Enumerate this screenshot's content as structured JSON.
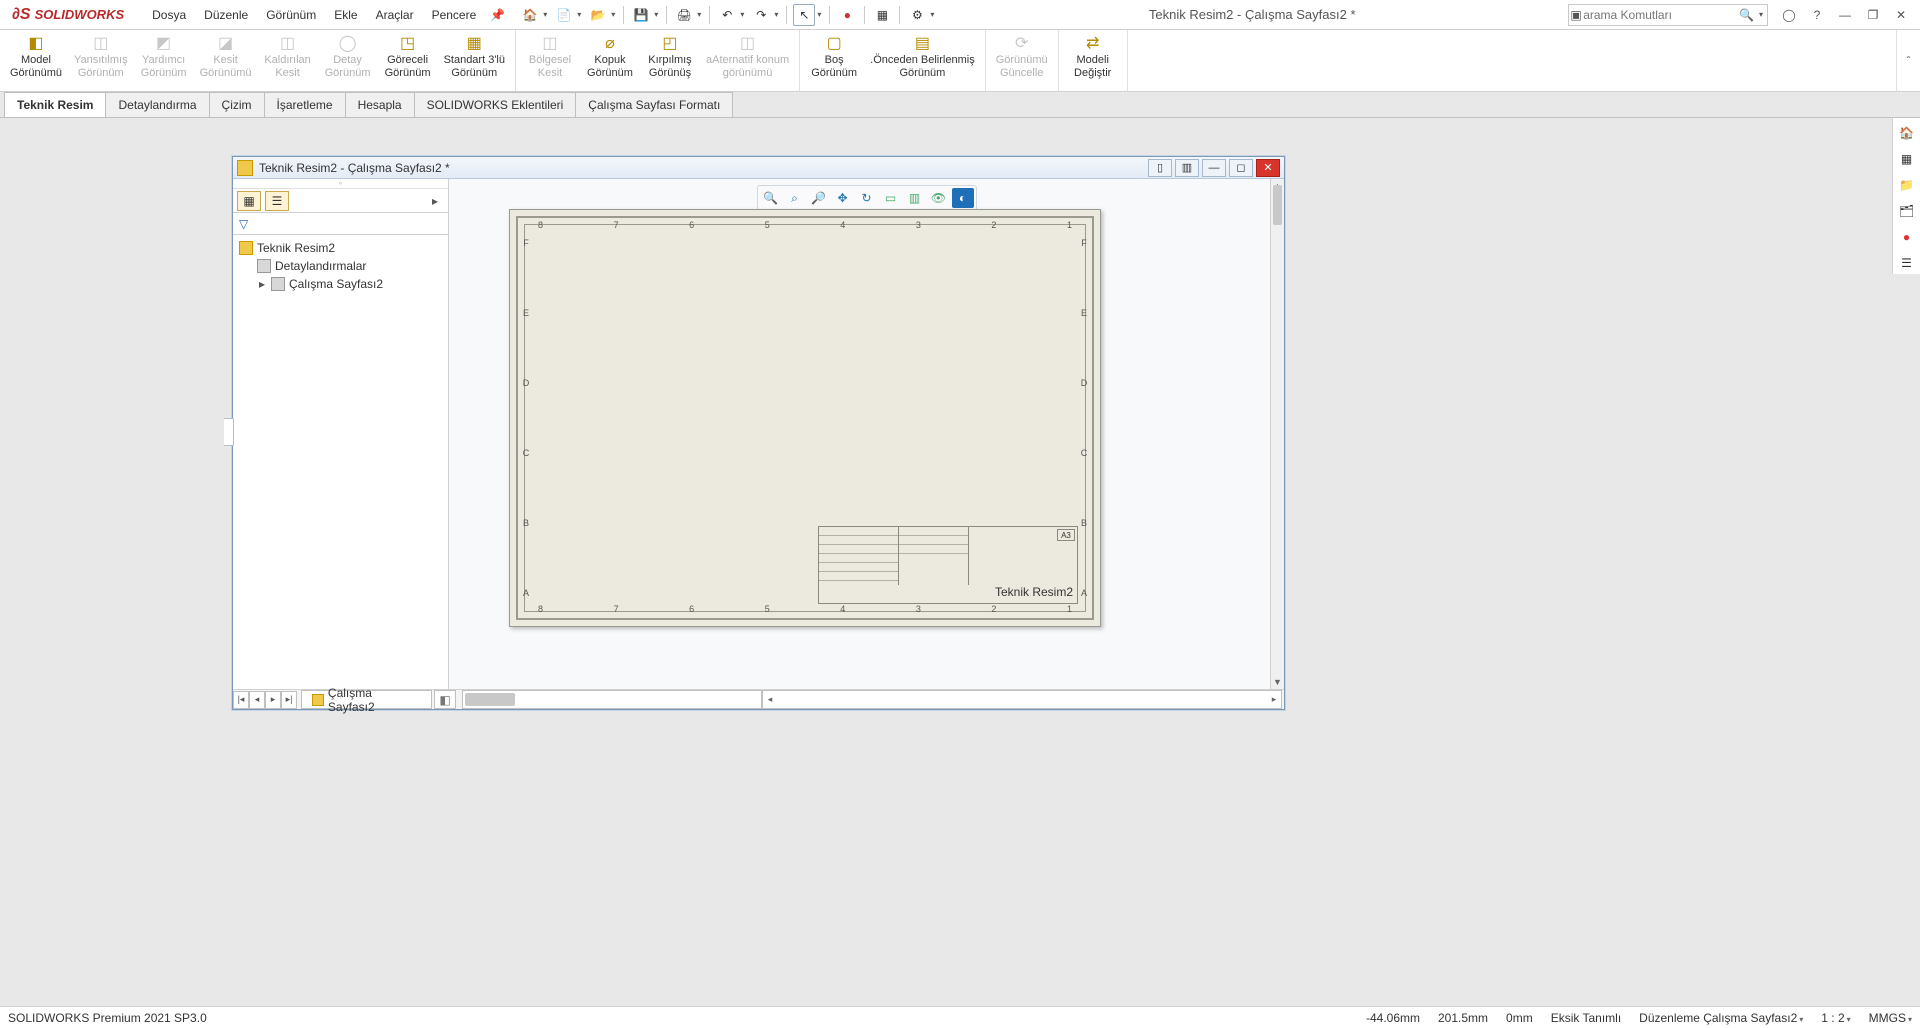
{
  "app": {
    "name": "SOLIDWORKS",
    "doc_title": "Teknik Resim2 - Çalışma Sayfası2 *"
  },
  "menu": [
    "Dosya",
    "Düzenle",
    "Görünüm",
    "Ekle",
    "Araçlar",
    "Pencere"
  ],
  "search": {
    "placeholder": "arama Komutları"
  },
  "ribbon": [
    {
      "label1": "Model",
      "label2": "Görünümü",
      "enabled": true
    },
    {
      "label1": "Yansıtılmış",
      "label2": "Görünüm",
      "enabled": false
    },
    {
      "label1": "Yardımcı",
      "label2": "Görünüm",
      "enabled": false
    },
    {
      "label1": "Kesit",
      "label2": "Görünümü",
      "enabled": false
    },
    {
      "label1": "Kaldırılan",
      "label2": "Kesit",
      "enabled": false
    },
    {
      "label1": "Detay",
      "label2": "Görünüm",
      "enabled": false
    },
    {
      "label1": "Göreceli",
      "label2": "Görünüm",
      "enabled": true
    },
    {
      "label1": "Standart 3'lü",
      "label2": "Görünüm",
      "enabled": true
    },
    {
      "label1": "Bölgesel",
      "label2": "Kesit",
      "enabled": false
    },
    {
      "label1": "Kopuk",
      "label2": "Görünüm",
      "enabled": true
    },
    {
      "label1": "Kırpılmış",
      "label2": "Görünüş",
      "enabled": true
    },
    {
      "label1": "aAternatif konum",
      "label2": "görünümü",
      "enabled": false
    },
    {
      "label1": "Boş",
      "label2": "Görünüm",
      "enabled": true
    },
    {
      "label1": ".Önceden Belirlenmiş",
      "label2": "Görünüm",
      "enabled": true
    },
    {
      "label1": "Görünümü",
      "label2": "Güncelle",
      "enabled": false
    },
    {
      "label1": "Modeli",
      "label2": "Değiştir",
      "enabled": true
    }
  ],
  "tabs": [
    "Teknik Resim",
    "Detaylandırma",
    "Çizim",
    "İşaretleme",
    "Hesapla",
    "SOLIDWORKS Eklentileri",
    "Çalışma Sayfası Formatı"
  ],
  "active_tab_index": 0,
  "mdi": {
    "title": "Teknik Resim2 - Çalışma Sayfası2 *",
    "tree_root": "Teknik Resim2",
    "tree_child1": "Detaylandırmalar",
    "tree_child2": "Çalışma Sayfası2",
    "ruler_top": [
      "8",
      "7",
      "6",
      "5",
      "4",
      "3",
      "2",
      "1"
    ],
    "ruler_side": [
      "F",
      "E",
      "D",
      "C",
      "B",
      "A"
    ],
    "titleblock_main": "Teknik Resim2",
    "titleblock_size": "A3",
    "sheet_tab": "Çalışma Sayfası2"
  },
  "status": {
    "product": "SOLIDWORKS Premium 2021 SP3.0",
    "x": "-44.06mm",
    "y": "201.5mm",
    "z": "0mm",
    "defined": "Eksik Tanımlı",
    "editing": "Düzenleme Çalışma Sayfası2",
    "scale": "1 : 2",
    "units": "MMGS"
  }
}
